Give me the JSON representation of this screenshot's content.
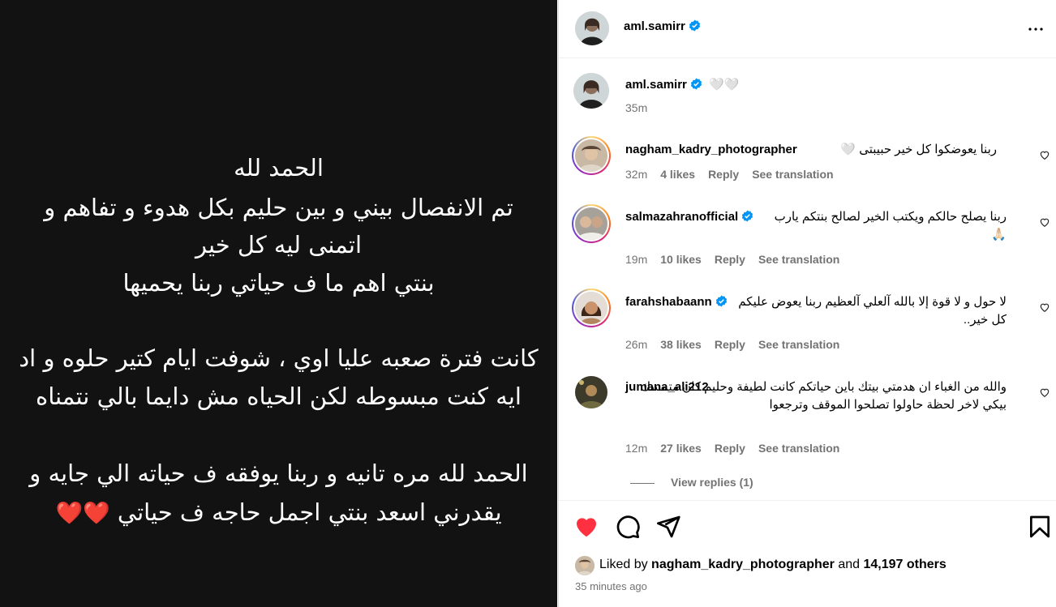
{
  "story": {
    "lines": [
      "الحمد لله",
      "تم الانفصال بيني و بين حليم بكل هدوء و تفاهم و",
      "اتمنى ليه كل خير",
      "بنتي اهم ما ف حياتي ربنا يحميها",
      "كانت فترة صعبه عليا اوي ، شوفت ايام كتير حلوه و اد",
      "ايه كنت مبسوطه لكن الحياه مش دايما بالي نتمناه",
      "الحمد لله مره تانيه و ربنا يوفقه ف حياته الي جايه و",
      "يقدرني اسعد بنتي اجمل حاجه ف حياتي"
    ],
    "hearts": "❤️❤️"
  },
  "post": {
    "author": "aml.samirr",
    "caption_suffix": "🤍🤍",
    "caption_time": "35m"
  },
  "comments": [
    {
      "user": "nagham_kadry_photographer",
      "verified": false,
      "text": "ربنا يعوضكوا كل خير حبيبتى 🤍",
      "time": "32m",
      "likes": "4 likes",
      "reply": "Reply",
      "translate": "See translation"
    },
    {
      "user": "salmazahranofficial",
      "verified": true,
      "text": "ربنا يصلح حالكم ويكتب الخير لصالح بنتكم يارب 🙏🏻",
      "time": "19m",
      "likes": "10 likes",
      "reply": "Reply",
      "translate": "See translation"
    },
    {
      "user": "farahshabaann",
      "verified": true,
      "text": "لا حول و لا قوة إلا بالله آلعلي آلعظيم ربنا يعوض عليكم كل خير..",
      "time": "26m",
      "likes": "38 likes",
      "reply": "Reply",
      "translate": "See translation"
    },
    {
      "user": "jumana_ali212",
      "verified": false,
      "text": "والله من الغباء ان هدمتي بيتك باين حياتكم كانت لطيفة وحليم كان متمسك بيكي لاخر لحظة حاولوا تصلحوا الموقف وترجعوا",
      "time": "12m",
      "likes": "27 likes",
      "reply": "Reply",
      "translate": "See translation"
    }
  ],
  "view_replies": "View replies (1)",
  "likes": {
    "prefix": "Liked by",
    "user": "nagham_kadry_photographer",
    "and": "and",
    "others": "14,197 others"
  },
  "posted_ago": "35 minutes ago",
  "colors": {
    "like_red": "#ff3040",
    "verified_blue": "#0095f6",
    "muted": "#737373"
  },
  "icons": [
    "heart-icon",
    "comment-icon",
    "share-icon",
    "bookmark-icon",
    "more-icon",
    "verified-icon"
  ]
}
